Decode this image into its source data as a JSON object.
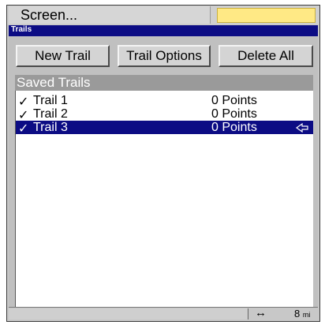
{
  "topbar": {
    "screen_label": "Screen..."
  },
  "window": {
    "title": "Trails"
  },
  "buttons": {
    "new_trail": "New Trail",
    "trail_options": "Trail Options",
    "delete_all": "Delete All"
  },
  "list": {
    "header": "Saved Trails",
    "items": [
      {
        "check": "✓",
        "name": "Trail 1",
        "points": "0 Points",
        "selected": false
      },
      {
        "check": "✓",
        "name": "Trail 2",
        "points": "0 Points",
        "selected": false
      },
      {
        "check": "✓",
        "name": "Trail 3",
        "points": "0 Points",
        "selected": true
      }
    ]
  },
  "status": {
    "arrow": "↔",
    "scale_value": "8",
    "scale_unit": "mi"
  },
  "colors": {
    "title_bar": "#0c0c84",
    "selection": "#0c0c84",
    "field_yellow": "#ffe985"
  },
  "icons": {
    "selected_row": "left-arrow-icon",
    "status": "horizontal-arrows-icon"
  }
}
